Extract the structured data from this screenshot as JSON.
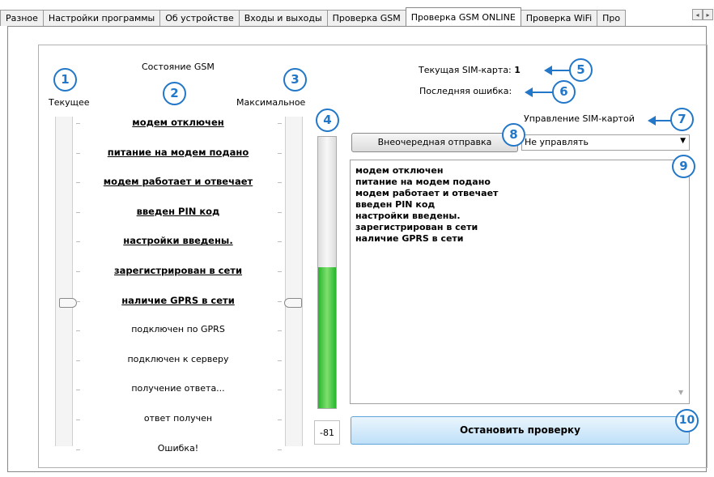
{
  "tabs": [
    "Разное",
    "Настройки программы",
    "Об устройстве",
    "Входы и выходы",
    "Проверка GSM",
    "Проверка GSM ONLINE",
    "Проверка WiFi",
    "Про"
  ],
  "active_tab": 5,
  "tab_scroll": {
    "left": "◂",
    "right": "▸"
  },
  "gsm": {
    "title": "Состояние GSM",
    "current_label": "Текущее",
    "max_label": "Максимальное",
    "states": [
      {
        "text": "модем отключен",
        "done": true
      },
      {
        "text": "питание на модем подано",
        "done": true
      },
      {
        "text": "модем работает и отвечает",
        "done": true
      },
      {
        "text": "введен PIN код",
        "done": true
      },
      {
        "text": "настройки введены.",
        "done": true
      },
      {
        "text": "зарегистрирован в сети",
        "done": true
      },
      {
        "text": "наличие GPRS в сети",
        "done": true
      },
      {
        "text": "подключен по GPRS",
        "done": false
      },
      {
        "text": "подключен к серверу",
        "done": false
      },
      {
        "text": "получение ответа...",
        "done": false
      },
      {
        "text": "ответ получен",
        "done": false
      },
      {
        "text": "Ошибка!",
        "done": false
      }
    ],
    "current_level_index": 6,
    "max_level_index": 6
  },
  "signal": {
    "value": "-81",
    "fill_fraction": 0.52
  },
  "sim": {
    "current_label": "Текущая SIM-карта:",
    "current_value": "1",
    "last_error_label": "Последняя ошибка:",
    "last_error_value": "",
    "control_label": "Управление SIM-картой",
    "control_selected": "Не управлять"
  },
  "buttons": {
    "send_now": "Внеочередная отправка",
    "stop": "Остановить проверку"
  },
  "log_text": "модем отключен\nпитание на модем подано\nмодем работает и отвечает\nвведен PIN код\nнастройки введены.\nзарегистрирован в сети\nналичие GPRS в сети",
  "callouts": [
    "1",
    "2",
    "3",
    "4",
    "5",
    "6",
    "7",
    "8",
    "9",
    "10"
  ],
  "colors": {
    "callout": "#2277c9",
    "signal_bar": "#2ec132"
  }
}
